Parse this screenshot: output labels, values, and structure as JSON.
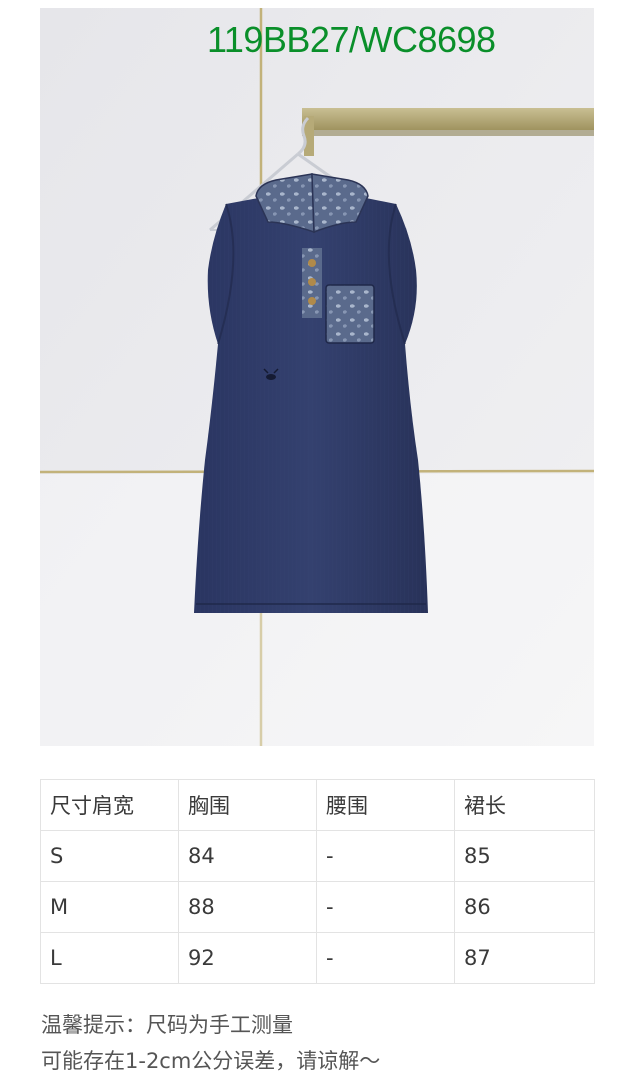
{
  "photo": {
    "overlay_code": "119BB27/WC8698",
    "overlay_color": "#0a8f2a",
    "subject": "sleeveless-denim-dress-icon",
    "colors": {
      "wall": "#e9e9ec",
      "denim": "#2f3b68",
      "trim": "#b9a66a"
    }
  },
  "size_table": {
    "headers": [
      "尺寸肩宽",
      "胸围",
      "腰围",
      "裙长"
    ],
    "rows": [
      [
        "S",
        "84",
        "-",
        "85"
      ],
      [
        "M",
        "88",
        "-",
        "86"
      ],
      [
        "L",
        "92",
        "-",
        "87"
      ]
    ]
  },
  "notes": {
    "line1": "温馨提示：尺码为手工测量",
    "line2": "可能存在1-2cm公分误差，请谅解～"
  }
}
